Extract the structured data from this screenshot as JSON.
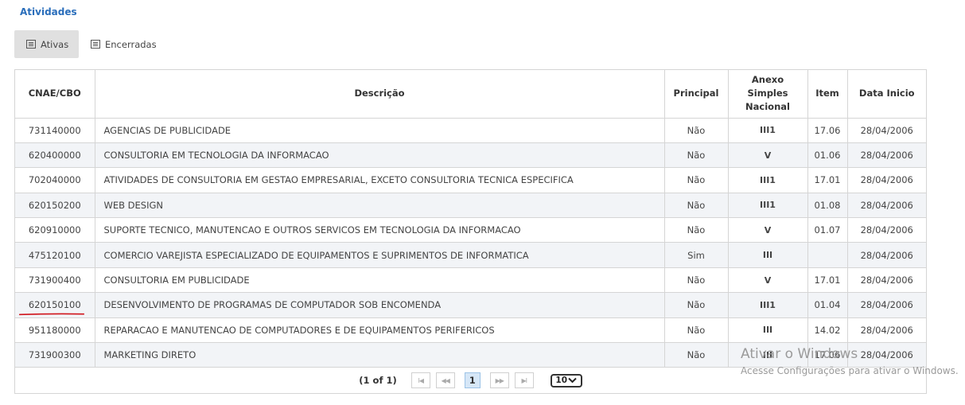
{
  "section": {
    "title": "Atividades"
  },
  "tabs": [
    {
      "label": "Ativas",
      "icon": "list-icon",
      "active": true
    },
    {
      "label": "Encerradas",
      "icon": "list-icon",
      "active": false
    }
  ],
  "table": {
    "headers": [
      "CNAE/CBO",
      "Descrição",
      "Principal",
      "Anexo Simples Nacional",
      "Item",
      "Data Inicio"
    ],
    "rows": [
      {
        "code": "731140000",
        "desc": "AGENCIAS DE PUBLICIDADE",
        "principal": "Não",
        "anexo": "III1",
        "item": "17.06",
        "date": "28/04/2006"
      },
      {
        "code": "620400000",
        "desc": "CONSULTORIA EM TECNOLOGIA DA INFORMACAO",
        "principal": "Não",
        "anexo": "V",
        "item": "01.06",
        "date": "28/04/2006"
      },
      {
        "code": "702040000",
        "desc": "ATIVIDADES DE CONSULTORIA EM GESTAO EMPRESARIAL, EXCETO CONSULTORIA TECNICA ESPECIFICA",
        "principal": "Não",
        "anexo": "III1",
        "item": "17.01",
        "date": "28/04/2006"
      },
      {
        "code": "620150200",
        "desc": "WEB DESIGN",
        "principal": "Não",
        "anexo": "III1",
        "item": "01.08",
        "date": "28/04/2006"
      },
      {
        "code": "620910000",
        "desc": "SUPORTE TECNICO, MANUTENCAO E OUTROS SERVICOS EM TECNOLOGIA DA INFORMACAO",
        "principal": "Não",
        "anexo": "V",
        "item": "01.07",
        "date": "28/04/2006"
      },
      {
        "code": "475120100",
        "desc": "COMERCIO VAREJISTA ESPECIALIZADO DE EQUIPAMENTOS E SUPRIMENTOS DE INFORMATICA",
        "principal": "Sim",
        "anexo": "III",
        "item": "",
        "date": "28/04/2006"
      },
      {
        "code": "731900400",
        "desc": "CONSULTORIA EM PUBLICIDADE",
        "principal": "Não",
        "anexo": "V",
        "item": "17.01",
        "date": "28/04/2006"
      },
      {
        "code": "620150100",
        "desc": "DESENVOLVIMENTO DE PROGRAMAS DE COMPUTADOR SOB ENCOMENDA",
        "principal": "Não",
        "anexo": "III1",
        "item": "01.04",
        "date": "28/04/2006",
        "underlined": true
      },
      {
        "code": "951180000",
        "desc": "REPARACAO E MANUTENCAO DE COMPUTADORES E DE EQUIPAMENTOS PERIFERICOS",
        "principal": "Não",
        "anexo": "III",
        "item": "14.02",
        "date": "28/04/2006"
      },
      {
        "code": "731900300",
        "desc": "MARKETING DIRETO",
        "principal": "Não",
        "anexo": "III",
        "item": "17.06",
        "date": "28/04/2006"
      }
    ]
  },
  "pager": {
    "count": "(1 of 1)",
    "current_page": "1",
    "first_label": "I◀",
    "prev_label": "◀◀",
    "next_label": "▶▶",
    "last_label": "▶I",
    "rows_per_page": "10"
  },
  "watermark": {
    "line1": "Ativar o Windows",
    "line2": "Acesse Configurações para ativar o Windows."
  },
  "colors": {
    "title": "#2a6ebb",
    "row_alt": "#f2f4f7",
    "active_tab": "#e0e0e0",
    "annotation_underline": "#d0141b",
    "current_page": "#d6e7f7"
  }
}
